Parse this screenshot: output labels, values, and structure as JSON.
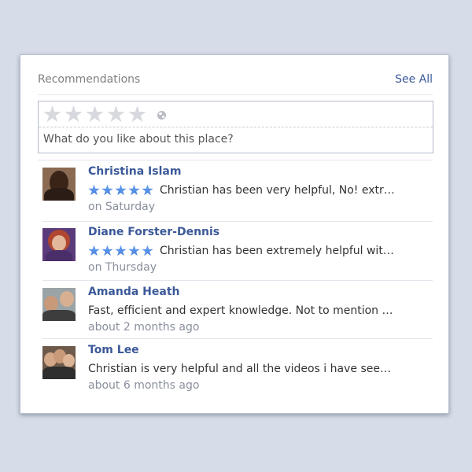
{
  "header": {
    "title": "Recommendations",
    "see_all_label": "See All"
  },
  "compose": {
    "placeholder": "What do you like about this place?",
    "rating_max": 5,
    "rating_icon": "star-outline-icon",
    "privacy_icon": "globe-icon"
  },
  "colors": {
    "background": "#d6dde8",
    "link": "#3b5998",
    "star_filled": "#4f8ae6",
    "star_empty": "#d7d9de",
    "muted_text": "#898f9c"
  },
  "reviews": [
    {
      "name": "Christina Islam",
      "rating": 5,
      "text": "Christian has been very helpful, No! extr…",
      "time": "on Saturday"
    },
    {
      "name": "Diane Forster-Dennis",
      "rating": 5,
      "text": "Christian has been extremely helpful wit…",
      "time": "on Thursday"
    },
    {
      "name": "Amanda Heath",
      "rating": null,
      "text": "Fast, efficient and expert knowledge. Not to mention s…",
      "time": "about 2 months ago"
    },
    {
      "name": "Tom Lee",
      "rating": null,
      "text": "Christian is very helpful and all the videos i have seen …",
      "time": "about 6 months ago"
    }
  ]
}
